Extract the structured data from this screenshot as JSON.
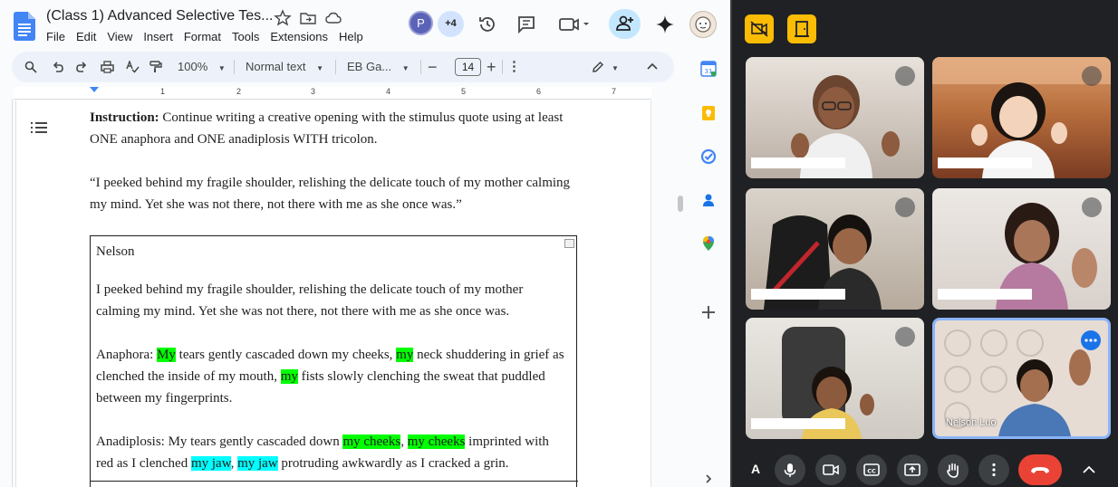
{
  "doc": {
    "title": "(Class 1) Advanced Selective Tes...",
    "menu": [
      "File",
      "Edit",
      "View",
      "Insert",
      "Format",
      "Tools",
      "Extensions",
      "Help"
    ],
    "collaborators": {
      "avatar_letter": "P",
      "extra_count": "+4"
    },
    "toolbar": {
      "zoom": "100%",
      "style": "Normal text",
      "font": "EB Ga...",
      "font_size": "14"
    },
    "ruler_numbers": [
      "1",
      "2",
      "3",
      "4",
      "5",
      "6",
      "7"
    ],
    "instruction_label": "Instruction:",
    "instruction_text": " Continue writing a creative opening with the stimulus quote using at least ONE anaphora and ONE anadiplosis WITH tricolon.",
    "quote": "“I peeked behind my fragile shoulder, relishing the delicate touch of my mother calming my mind. Yet she was not there, not there with me as she once was.”",
    "box": {
      "name": "Nelson",
      "paragraph": "I peeked behind my fragile shoulder, relishing the delicate touch of my mother calming my mind. Yet she was not there, not there with me as she once was.",
      "anaphora": {
        "p1": "Anaphora: ",
        "h1": "My",
        "p2": " tears gently cascaded down my cheeks, ",
        "h2": "my",
        "p3": " neck shuddering in grief as clenched the inside of my mouth, ",
        "h3": "my",
        "p4": " fists slowly clenching the sweat that puddled between my fingerprints."
      },
      "anadiplosis": {
        "p1": "Anadiplosis: My tears gently cascaded down ",
        "h1": "my cheeks",
        "p2": ", ",
        "h2": "my cheeks",
        "p3": " imprinted with red as I clenched ",
        "h3": "my jaw",
        "p4": ", ",
        "h4": "my jaw",
        "p5": " protruding awkwardly as I cracked a grin."
      }
    }
  },
  "meet": {
    "self_tile_name": "Nelson Luo",
    "caption_button": "A",
    "colors": {
      "accent": "#1a73e8",
      "end_call": "#ea4335",
      "tile_border": "#8ab4f8",
      "yellow": "#fbbc04"
    }
  }
}
